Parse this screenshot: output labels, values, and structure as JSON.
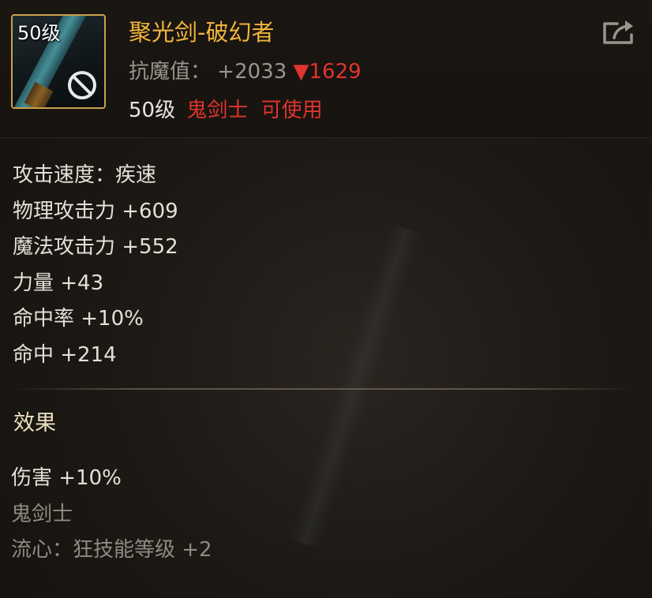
{
  "item": {
    "icon_level": "50级",
    "icon_name": "sword-icon",
    "forbidden_icon": "forbidden-icon",
    "name": "聚光剑-破幻者",
    "defense_label": "抗魔值：",
    "defense_value": "+2033",
    "defense_down": "▼1629",
    "req_level": "50级",
    "req_class": "鬼剑士",
    "req_usable": "可使用",
    "share_icon": "share-icon"
  },
  "stats": [
    "攻击速度：疾速",
    "物理攻击力 +609",
    "魔法攻击力 +552",
    "力量 +43",
    "命中率 +10%",
    "命中 +214"
  ],
  "effect": {
    "title": "效果",
    "lines": [
      "伤害 +10%",
      "鬼剑士",
      "流心：狂技能等级 +2"
    ]
  },
  "colors": {
    "name": "#f0b43a",
    "warning": "#e0342e",
    "stat_text": "#e4e0d8",
    "muted": "#8f8a82",
    "icon_border": "#c9a14a"
  }
}
